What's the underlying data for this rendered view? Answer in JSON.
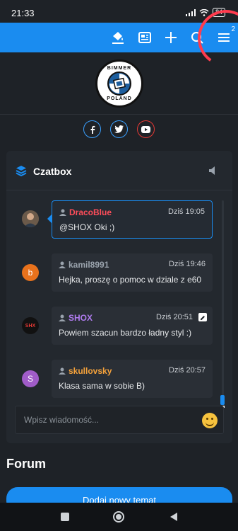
{
  "status_bar": {
    "time": "21:33",
    "battery": "84"
  },
  "topbar": {
    "notifications_count": "2"
  },
  "logo": {
    "top_text": "BIMMER",
    "bottom_text": "POLAND"
  },
  "chatbox": {
    "title": "Czatbox",
    "messages": [
      {
        "nick": "DracoBlue",
        "nick_color": "#ff4d5a",
        "time": "Dziś 19:05",
        "text": "@SHOX Oki ;)",
        "avatar_letter": ""
      },
      {
        "nick": "kamil8991",
        "nick_color": "#9aa3ad",
        "time": "Dziś 19:46",
        "text": "Hejka, proszę o pomoc w dziale z e60",
        "avatar_letter": "b"
      },
      {
        "nick": "SHOX",
        "nick_color": "#b07cf0",
        "time": "Dziś 20:51",
        "text": "Powiem szacun bardzo ładny styl :)",
        "avatar_letter": "SHX"
      },
      {
        "nick": "skullovsky",
        "nick_color": "#f5a23b",
        "time": "Dziś 20:57",
        "text": "Klasa sama w sobie B)",
        "avatar_letter": "S"
      }
    ],
    "input_placeholder": "Wpisz wiadomość..."
  },
  "forum": {
    "title": "Forum",
    "new_topic_label": "Dodaj nowy temat"
  }
}
